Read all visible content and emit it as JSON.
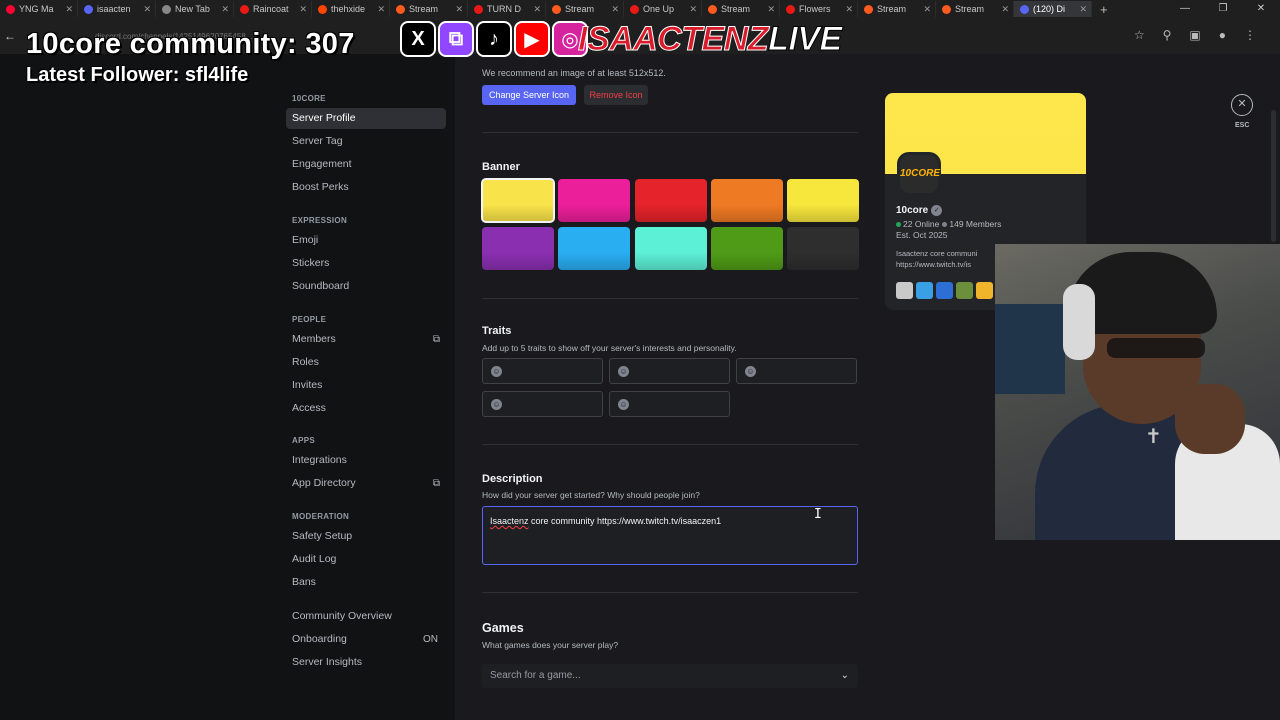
{
  "browser": {
    "tabs": [
      {
        "title": "YNG Ma",
        "color": "#ff0033"
      },
      {
        "title": "isaacten",
        "color": "#5865f2"
      },
      {
        "title": "New Tab",
        "color": "#888888"
      },
      {
        "title": "Raincoat",
        "color": "#e91916"
      },
      {
        "title": "thehxide",
        "color": "#ff4500"
      },
      {
        "title": "Stream",
        "color": "#ff5a1f"
      },
      {
        "title": "TURN D",
        "color": "#e91916"
      },
      {
        "title": "Stream",
        "color": "#ff5a1f"
      },
      {
        "title": "One Up",
        "color": "#e91916"
      },
      {
        "title": "Stream",
        "color": "#ff5a1f"
      },
      {
        "title": "Flowers",
        "color": "#e91916"
      },
      {
        "title": "Stream",
        "color": "#ff5a1f"
      },
      {
        "title": "Stream",
        "color": "#ff5a1f"
      },
      {
        "title": "(120) Di",
        "color": "#5865f2",
        "active": true
      }
    ],
    "url": "discord.com/channels/1425149620765458..."
  },
  "overlay": {
    "community": "10core community: 307",
    "follower": "Latest Follower: sfl4life",
    "social_icons": [
      "x-icon",
      "twitch-icon",
      "tiktok-icon",
      "youtube-icon",
      "instagram-icon"
    ],
    "brand_red": "ISAACTENZ",
    "brand_white": "LIVE"
  },
  "sidebar": {
    "server_group": "10CORE",
    "server_items": [
      {
        "label": "Server Profile",
        "selected": true
      },
      {
        "label": "Server Tag"
      },
      {
        "label": "Engagement"
      },
      {
        "label": "Boost Perks"
      }
    ],
    "expression_group": "EXPRESSION",
    "expression_items": [
      {
        "label": "Emoji"
      },
      {
        "label": "Stickers"
      },
      {
        "label": "Soundboard"
      }
    ],
    "people_group": "PEOPLE",
    "people_items": [
      {
        "label": "Members"
      },
      {
        "label": "Roles"
      },
      {
        "label": "Invites"
      },
      {
        "label": "Access"
      }
    ],
    "apps_group": "APPS",
    "apps_items": [
      {
        "label": "Integrations"
      },
      {
        "label": "App Directory"
      }
    ],
    "moderation_group": "MODERATION",
    "moderation_items": [
      {
        "label": "Safety Setup"
      },
      {
        "label": "Audit Log"
      },
      {
        "label": "Bans"
      }
    ],
    "community_items": [
      {
        "label": "Community Overview"
      },
      {
        "label": "Onboarding",
        "badge": "ON"
      },
      {
        "label": "Server Insights"
      }
    ]
  },
  "icon_section": {
    "recommend": "We recommend an image of at least 512x512.",
    "change_button": "Change Server Icon",
    "remove_button": "Remove Icon"
  },
  "banner": {
    "title": "Banner",
    "colors": [
      "#f9e34a",
      "#ec1f9a",
      "#e5232a",
      "#ef7a24",
      "#f7e63c",
      "#8a2fb0",
      "#29aef2",
      "#5cf0d6",
      "#4f9b17",
      "#2e2e2e"
    ],
    "selected_index": 0
  },
  "traits": {
    "title": "Traits",
    "hint": "Add up to 5 traits to show off your server's interests and personality.",
    "count": 5
  },
  "description": {
    "title": "Description",
    "hint": "How did your server get started? Why should people join?",
    "value_misspelled": "Isaactenz",
    "value_rest": " core community https://www.twitch.tv/isaaczen1"
  },
  "games": {
    "title": "Games",
    "hint": "What games does your server play?",
    "placeholder": "Search for a game..."
  },
  "preview": {
    "icon_text": "10CORE",
    "name": "10core",
    "online": "22 Online",
    "members": "149 Members",
    "established": "Est. Oct 2025",
    "desc_line1": "Isaactenz core communi",
    "desc_line2": "https://www.twitch.tv/is",
    "emote_colors": [
      "#c9c9c9",
      "#3aa0e6",
      "#2d6fd6",
      "#6b8f3a",
      "#f0b52a"
    ]
  },
  "close": {
    "label": "ESC"
  }
}
